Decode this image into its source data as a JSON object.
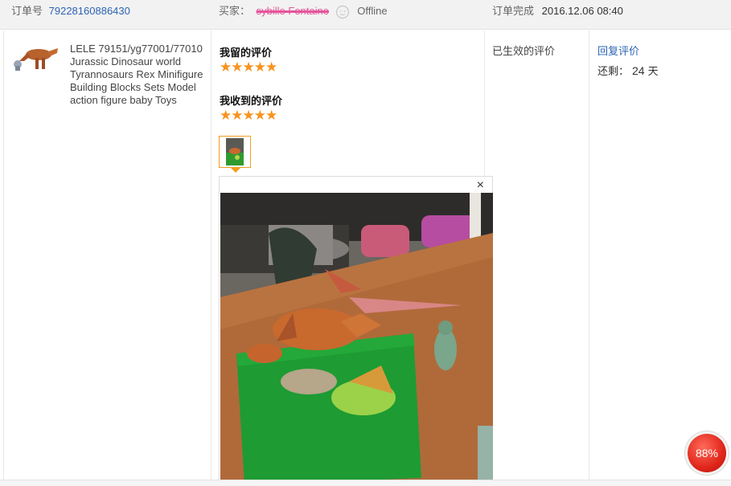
{
  "header": {
    "order_label": "订单号",
    "order_number": "79228160886430",
    "buyer_label": "买家：",
    "buyer_name": "sybille Fontaine",
    "buyer_status": "Offline",
    "completed_label": "订单完成",
    "completed_date": "2016.12.06 08:40"
  },
  "product": {
    "title": "LELE 79151/yg77001/77010 Jurassic Dinosaur world Tyrannosaurs Rex Minifigure Building Blocks Sets Model action figure baby Toys"
  },
  "reviews": {
    "my_review_label": "我留的评价",
    "my_stars": "★★★★★",
    "received_review_label": "我收到的评价",
    "received_stars": "★★★★★",
    "close_symbol": "×"
  },
  "status": {
    "valid_label": "已生效的评价",
    "reply_label": "回复评价",
    "remain_label": "还剩：",
    "remain_value": "24",
    "remain_unit": "天"
  },
  "badge": {
    "value": "88%"
  },
  "colors": {
    "link": "#2d64b3",
    "star": "#f7931e",
    "accent_border": "#f29c1f",
    "badge": "#e0261b"
  }
}
